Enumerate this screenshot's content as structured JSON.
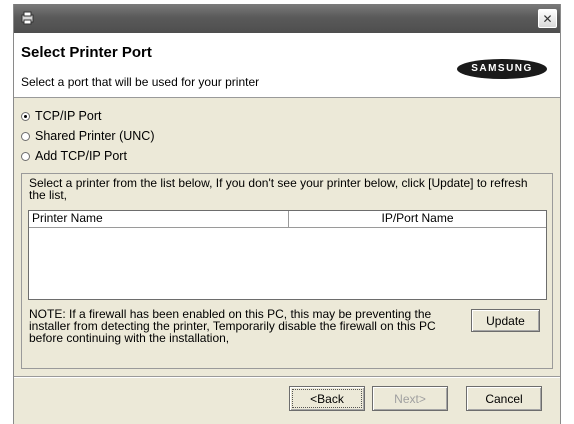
{
  "window": {
    "title": "",
    "close_glyph": "✕"
  },
  "header": {
    "title": "Select Printer Port",
    "subtitle": "Select a port that will be used for your printer",
    "logo_text": "SAMSUNG"
  },
  "ports": [
    {
      "label": "TCP/IP Port",
      "checked": true
    },
    {
      "label": "Shared Printer (UNC)",
      "checked": false
    },
    {
      "label": "Add TCP/IP Port",
      "checked": false
    }
  ],
  "instructions": "Select a printer from the list below, If you don't see your printer below, click [Update] to refresh the list,",
  "printer_list": {
    "columns": [
      "Printer Name",
      "IP/Port Name"
    ],
    "rows": []
  },
  "note": "NOTE: If a firewall has been enabled on this PC, this may be preventing the installer from detecting the printer, Temporarily disable the firewall on this PC before continuing with the installation,",
  "buttons": {
    "update": "Update",
    "back": "<Back",
    "next": "Next>",
    "cancel": "Cancel"
  },
  "colors": {
    "titlebar": "#5a5a5a",
    "dialog_bg": "#ece9d8",
    "logo_bg": "#1a1a1a"
  }
}
